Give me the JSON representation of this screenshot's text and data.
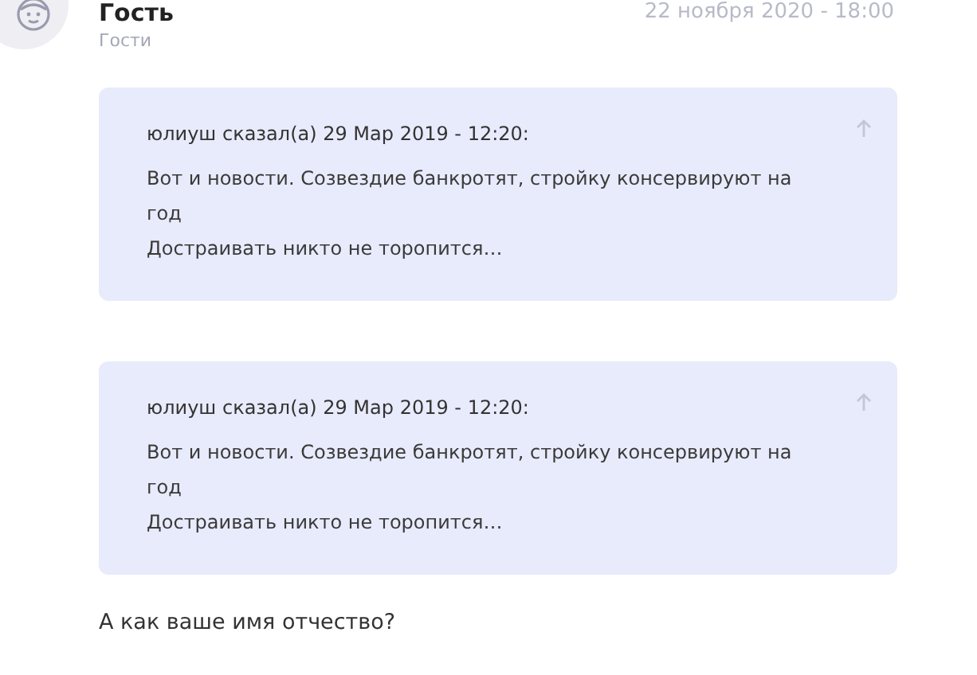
{
  "post": {
    "author": "Гость",
    "group": "Гости",
    "date": "22 ноября 2020 - 18:00"
  },
  "quotes": [
    {
      "header": "юлиуш сказал(а) 29 Мар 2019 - 12:20:",
      "lines": [
        "Вот и новости. Созвездие банкротят, стройку консервируют на год",
        "Достраивать никто не торопится…"
      ]
    },
    {
      "header": "юлиуш сказал(а) 29 Мар 2019 - 12:20:",
      "lines": [
        "Вот и новости. Созвездие банкротят, стройку консервируют на год",
        "Достраивать никто не торопится…"
      ]
    }
  ],
  "message": "А как ваше имя отчество?"
}
